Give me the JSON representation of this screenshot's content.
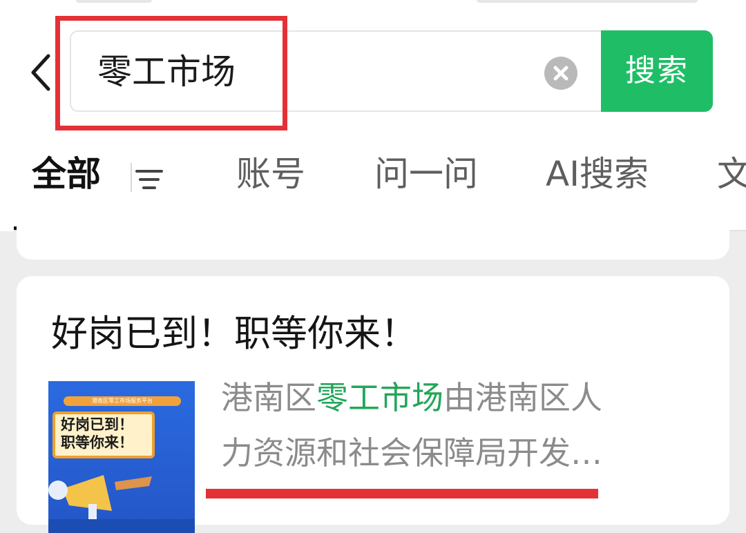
{
  "search": {
    "query": "零工市场",
    "button_label": "搜索"
  },
  "tabs": [
    {
      "label": "全部",
      "active": true
    },
    {
      "label": "账号",
      "active": false
    },
    {
      "label": "问一问",
      "active": false
    },
    {
      "label": "AI搜索",
      "active": false
    },
    {
      "label": "文",
      "active": false
    }
  ],
  "result": {
    "title": "好岗已到！职等你来！",
    "thumbnail": {
      "banner": "港南区零工市场服务平台",
      "line1": "好岗已到！",
      "line2": "职等你来！"
    },
    "desc_prefix": "港南区",
    "desc_highlight": "零工市场",
    "desc_suffix": "由港南区人",
    "desc_line2": "力资源和社会保障局开发…"
  },
  "colors": {
    "accent": "#1fbe66",
    "highlight_text": "#22a659",
    "annotation_red": "#e43136"
  },
  "icons": [
    "back-arrow-icon",
    "clear-icon",
    "filter-icon"
  ]
}
